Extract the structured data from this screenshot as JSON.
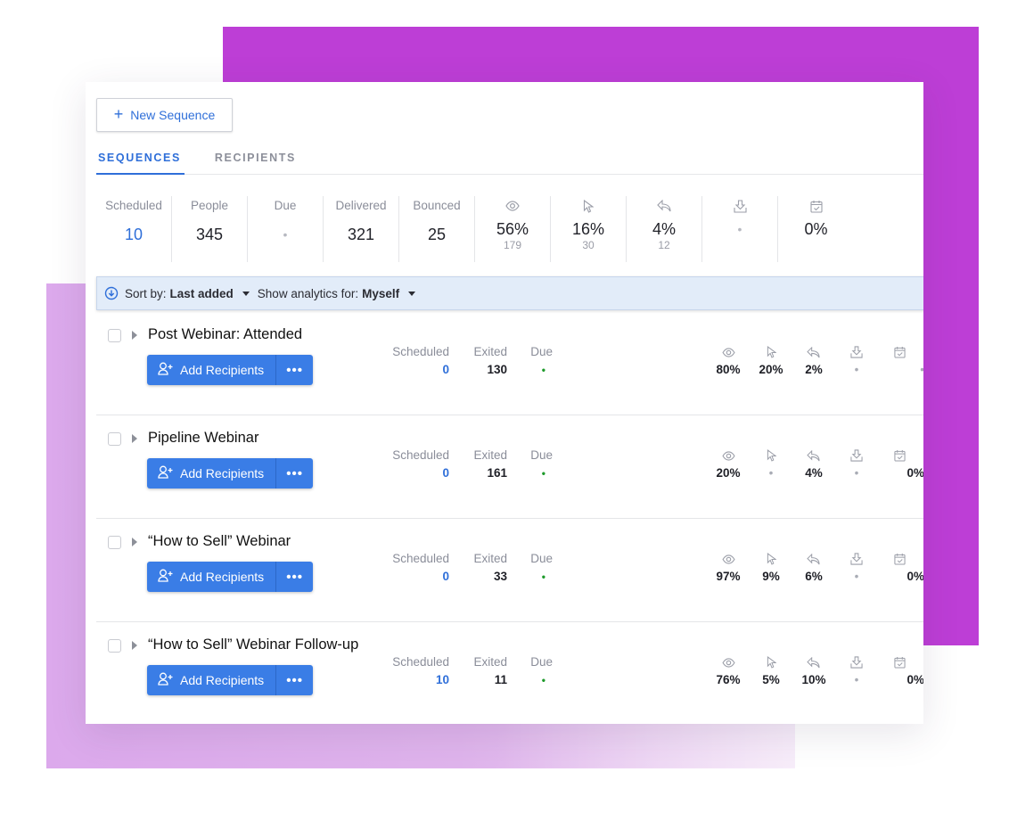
{
  "toolbar": {
    "new_sequence_label": "New Sequence",
    "new_sequence_icon": "plus-icon"
  },
  "tabs": [
    {
      "label": "SEQUENCES",
      "active": true
    },
    {
      "label": "RECIPIENTS",
      "active": false
    }
  ],
  "summary": {
    "scheduled": {
      "label": "Scheduled",
      "value": "10"
    },
    "people": {
      "label": "People",
      "value": "345"
    },
    "due": {
      "label": "Due",
      "value": "•"
    },
    "delivered": {
      "label": "Delivered",
      "value": "321"
    },
    "bounced": {
      "label": "Bounced",
      "value": "25"
    },
    "opened": {
      "icon": "eye-icon",
      "value": "56%",
      "count": "179"
    },
    "clicked": {
      "icon": "cursor-icon",
      "value": "16%",
      "count": "30"
    },
    "replied": {
      "icon": "reply-icon",
      "value": "4%",
      "count": "12"
    },
    "downloaded": {
      "icon": "download-icon",
      "value": "•"
    },
    "booked": {
      "icon": "calendar-check-icon",
      "value": "0%"
    }
  },
  "sortbar": {
    "sort_label": "Sort by:",
    "sort_value": "Last added",
    "analytics_label": "Show analytics for:",
    "analytics_value": "Myself"
  },
  "row_labels": {
    "add_recipients": "Add Recipients",
    "more": "•••",
    "scheduled": "Scheduled",
    "exited": "Exited",
    "due": "Due"
  },
  "sequences": [
    {
      "title": "Post Webinar: Attended",
      "scheduled": "0",
      "exited": "130",
      "due": "•",
      "opened": "80%",
      "clicked": "20%",
      "replied": "2%",
      "downloaded": "•",
      "booked": "•"
    },
    {
      "title": "Pipeline Webinar",
      "scheduled": "0",
      "exited": "161",
      "due": "•",
      "opened": "20%",
      "clicked": "•",
      "replied": "4%",
      "downloaded": "•",
      "booked": "0%"
    },
    {
      "title": "“How to Sell” Webinar",
      "scheduled": "0",
      "exited": "33",
      "due": "•",
      "opened": "97%",
      "clicked": "9%",
      "replied": "6%",
      "downloaded": "•",
      "booked": "0%"
    },
    {
      "title": "“How to Sell” Webinar Follow-up",
      "scheduled": "10",
      "exited": "11",
      "due": "•",
      "opened": "76%",
      "clicked": "5%",
      "replied": "10%",
      "downloaded": "•",
      "booked": "0%"
    }
  ],
  "colors": {
    "accent": "#2f6fd9",
    "button": "#3a7de6",
    "due_dot": "#1d9a2a",
    "bg_purple": "#bd3ed6",
    "bg_lavender": "#dca9ec"
  }
}
